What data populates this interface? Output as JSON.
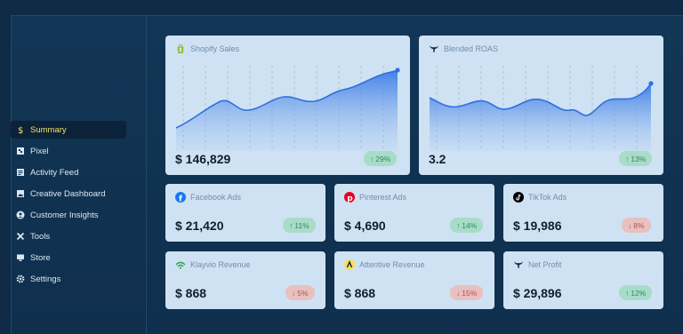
{
  "sidebar": {
    "items": [
      {
        "label": "Summary",
        "icon": "dollar-icon",
        "active": true
      },
      {
        "label": "Pixel",
        "icon": "pixel-icon",
        "active": false
      },
      {
        "label": "Activity Feed",
        "icon": "feed-icon",
        "active": false
      },
      {
        "label": "Creative Dashboard",
        "icon": "image-icon",
        "active": false
      },
      {
        "label": "Customer Insights",
        "icon": "user-icon",
        "active": false
      },
      {
        "label": "Tools",
        "icon": "tools-icon",
        "active": false
      },
      {
        "label": "Store",
        "icon": "store-icon",
        "active": false
      },
      {
        "label": "Settings",
        "icon": "gear-icon",
        "active": false
      }
    ]
  },
  "cards": {
    "shopify": {
      "title": "Shopify Sales",
      "value": "$ 146,829",
      "change": "29%",
      "direction": "up",
      "icon": "shopify-icon"
    },
    "roas": {
      "title": "Blended ROAS",
      "value": "3.2",
      "change": "13%",
      "direction": "up",
      "icon": "triple-whale-icon"
    },
    "facebook": {
      "title": "Facebook Ads",
      "value": "$ 21,420",
      "change": "11%",
      "direction": "up",
      "icon": "facebook-icon"
    },
    "pinterest": {
      "title": "Pinterest Ads",
      "value": "$ 4,690",
      "change": "14%",
      "direction": "up",
      "icon": "pinterest-icon"
    },
    "tiktok": {
      "title": "TikTok Ads",
      "value": "$ 19,986",
      "change": "8%",
      "direction": "down",
      "icon": "tiktok-icon"
    },
    "klaviyo": {
      "title": "Klayvio Revenue",
      "value": "$ 868",
      "change": "5%",
      "direction": "down",
      "icon": "klaviyo-icon"
    },
    "attentive": {
      "title": "Attentive Revenue",
      "value": "$ 868",
      "change": "15%",
      "direction": "down",
      "icon": "attentive-icon"
    },
    "netprofit": {
      "title": "Net Profit",
      "value": "$ 29,896",
      "change": "12%",
      "direction": "up",
      "icon": "triple-whale-icon"
    }
  },
  "colors": {
    "up": "#2f8a63",
    "down": "#b2524f",
    "accent": "#2f74e0",
    "active_nav": "#f0e26a"
  }
}
